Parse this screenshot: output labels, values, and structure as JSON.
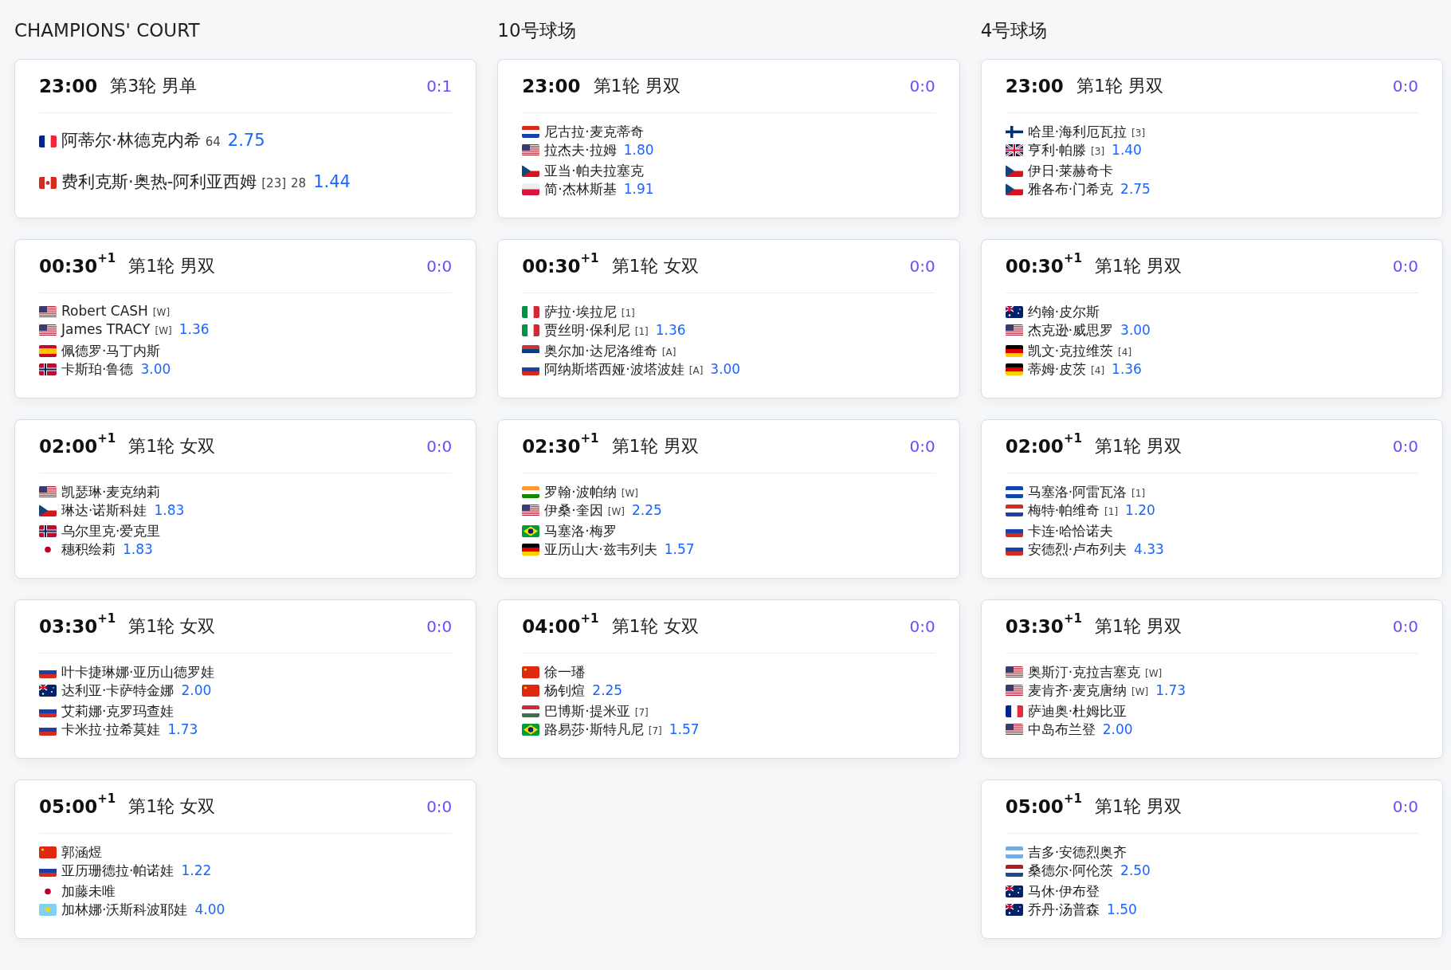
{
  "courts": [
    {
      "title": "CHAMPIONS' COURT",
      "matches": [
        {
          "time": "23:00",
          "round": "第3轮 男单",
          "score": "0:1",
          "sides": [
            {
              "players": [
                {
                  "kind": "fr",
                  "name": "阿蒂尔·林德克内希",
                  "ranking": "64"
                }
              ],
              "odds": "2.75"
            },
            {
              "players": [
                {
                  "kind": "ca",
                  "name": "费利克斯·奥热-阿利亚西姆",
                  "seed": "[23]",
                  "ranking": "28"
                }
              ],
              "odds": "1.44"
            }
          ]
        },
        {
          "time": "00:30",
          "day_offset": "+1",
          "round": "第1轮 男双",
          "score": "0:0",
          "sides": [
            {
              "players": [
                {
                  "kind": "us",
                  "name": "Robert CASH",
                  "seed": "[W]"
                },
                {
                  "kind": "us",
                  "name": "James TRACY",
                  "seed": "[W]"
                }
              ],
              "odds": "1.36"
            },
            {
              "players": [
                {
                  "kind": "es",
                  "name": "佩德罗·马丁内斯"
                },
                {
                  "kind": "no",
                  "name": "卡斯珀·鲁德"
                }
              ],
              "odds": "3.00"
            }
          ]
        },
        {
          "time": "02:00",
          "day_offset": "+1",
          "round": "第1轮 女双",
          "score": "0:0",
          "sides": [
            {
              "players": [
                {
                  "kind": "us",
                  "name": "凯瑟琳·麦克纳莉"
                },
                {
                  "kind": "cz",
                  "name": "琳达·诺斯科娃"
                }
              ],
              "odds": "1.83"
            },
            {
              "players": [
                {
                  "kind": "no",
                  "name": "乌尔里克·爱克里"
                },
                {
                  "kind": "jp",
                  "name": "穗积绘莉"
                }
              ],
              "odds": "1.83"
            }
          ]
        },
        {
          "time": "03:30",
          "day_offset": "+1",
          "round": "第1轮 女双",
          "score": "0:0",
          "sides": [
            {
              "players": [
                {
                  "kind": "ru",
                  "name": "叶卡捷琳娜·亚历山德罗娃"
                },
                {
                  "kind": "au",
                  "name": "达利亚·卡萨特金娜"
                }
              ],
              "odds": "2.00"
            },
            {
              "players": [
                {
                  "kind": "ru",
                  "name": "艾莉娜·克罗玛查娃"
                },
                {
                  "kind": "ru",
                  "name": "卡米拉·拉希莫娃"
                }
              ],
              "odds": "1.73"
            }
          ]
        },
        {
          "time": "05:00",
          "day_offset": "+1",
          "round": "第1轮 女双",
          "score": "0:0",
          "sides": [
            {
              "players": [
                {
                  "kind": "cn",
                  "name": "郭涵煜"
                },
                {
                  "kind": "ru",
                  "name": "亚历珊德拉·帕诺娃"
                }
              ],
              "odds": "1.22"
            },
            {
              "players": [
                {
                  "kind": "jp",
                  "name": "加藤未唯"
                },
                {
                  "kind": "kz",
                  "name": "加林娜·沃斯科波耶娃"
                }
              ],
              "odds": "4.00"
            }
          ]
        }
      ]
    },
    {
      "title": "10号球场",
      "matches": [
        {
          "time": "23:00",
          "round": "第1轮 男双",
          "score": "0:0",
          "sides": [
            {
              "players": [
                {
                  "kind": "hr",
                  "name": "尼古拉·麦克蒂奇"
                },
                {
                  "kind": "us",
                  "name": "拉杰夫·拉姆"
                }
              ],
              "odds": "1.80"
            },
            {
              "players": [
                {
                  "kind": "cz",
                  "name": "亚当·帕夫拉塞克"
                },
                {
                  "kind": "pl",
                  "name": "简·杰林斯基"
                }
              ],
              "odds": "1.91"
            }
          ]
        },
        {
          "time": "00:30",
          "day_offset": "+1",
          "round": "第1轮 女双",
          "score": "0:0",
          "sides": [
            {
              "players": [
                {
                  "kind": "it",
                  "name": "萨拉·埃拉尼",
                  "seed": "[1]"
                },
                {
                  "kind": "it",
                  "name": "贾丝明·保利尼",
                  "seed": "[1]"
                }
              ],
              "odds": "1.36"
            },
            {
              "players": [
                {
                  "kind": "rs",
                  "name": "奥尔加·达尼洛维奇",
                  "seed": "[A]"
                },
                {
                  "kind": "ru",
                  "name": "阿纳斯塔西娅·波塔波娃",
                  "seed": "[A]"
                }
              ],
              "odds": "3.00"
            }
          ]
        },
        {
          "time": "02:30",
          "day_offset": "+1",
          "round": "第1轮 男双",
          "score": "0:0",
          "sides": [
            {
              "players": [
                {
                  "kind": "in",
                  "name": "罗翰·波帕纳",
                  "seed": "[W]"
                },
                {
                  "kind": "us",
                  "name": "伊桑·奎因",
                  "seed": "[W]"
                }
              ],
              "odds": "2.25"
            },
            {
              "players": [
                {
                  "kind": "br",
                  "name": "马塞洛·梅罗"
                },
                {
                  "kind": "de",
                  "name": "亚历山大·兹韦列夫"
                }
              ],
              "odds": "1.57"
            }
          ]
        },
        {
          "time": "04:00",
          "day_offset": "+1",
          "round": "第1轮 女双",
          "score": "0:0",
          "sides": [
            {
              "players": [
                {
                  "kind": "cn",
                  "name": "徐一璠"
                },
                {
                  "kind": "cn",
                  "name": "杨钊煊"
                }
              ],
              "odds": "2.25"
            },
            {
              "players": [
                {
                  "kind": "hu",
                  "name": "巴博斯·提米亚",
                  "seed": "[7]"
                },
                {
                  "kind": "br",
                  "name": "路易莎·斯特凡尼",
                  "seed": "[7]"
                }
              ],
              "odds": "1.57"
            }
          ]
        }
      ]
    },
    {
      "title": "4号球场",
      "matches": [
        {
          "time": "23:00",
          "round": "第1轮 男双",
          "score": "0:0",
          "sides": [
            {
              "players": [
                {
                  "kind": "fi",
                  "name": "哈里·海利厄瓦拉",
                  "seed": "[3]"
                },
                {
                  "kind": "gb",
                  "name": "亨利·帕滕",
                  "seed": "[3]"
                }
              ],
              "odds": "1.40"
            },
            {
              "players": [
                {
                  "kind": "cz",
                  "name": "伊日·莱赫奇卡"
                },
                {
                  "kind": "cz",
                  "name": "雅各布·门希克"
                }
              ],
              "odds": "2.75"
            }
          ]
        },
        {
          "time": "00:30",
          "day_offset": "+1",
          "round": "第1轮 男双",
          "score": "0:0",
          "sides": [
            {
              "players": [
                {
                  "kind": "au",
                  "name": "约翰·皮尔斯"
                },
                {
                  "kind": "us",
                  "name": "杰克逊·威思罗"
                }
              ],
              "odds": "3.00"
            },
            {
              "players": [
                {
                  "kind": "de",
                  "name": "凯文·克拉维茨",
                  "seed": "[4]"
                },
                {
                  "kind": "de",
                  "name": "蒂姆·皮茨",
                  "seed": "[4]"
                }
              ],
              "odds": "1.36"
            }
          ]
        },
        {
          "time": "02:00",
          "day_offset": "+1",
          "round": "第1轮 男双",
          "score": "0:0",
          "sides": [
            {
              "players": [
                {
                  "kind": "sv",
                  "name": "马塞洛·阿雷瓦洛",
                  "seed": "[1]"
                },
                {
                  "kind": "hr",
                  "name": "梅特·帕维奇",
                  "seed": "[1]"
                }
              ],
              "odds": "1.20"
            },
            {
              "players": [
                {
                  "kind": "ru",
                  "name": "卡连·哈恰诺夫"
                },
                {
                  "kind": "ru",
                  "name": "安德烈·卢布列夫"
                }
              ],
              "odds": "4.33"
            }
          ]
        },
        {
          "time": "03:30",
          "day_offset": "+1",
          "round": "第1轮 男双",
          "score": "0:0",
          "sides": [
            {
              "players": [
                {
                  "kind": "us",
                  "name": "奥斯汀·克拉吉塞克",
                  "seed": "[W]"
                },
                {
                  "kind": "us",
                  "name": "麦肯齐·麦克唐纳",
                  "seed": "[W]"
                }
              ],
              "odds": "1.73"
            },
            {
              "players": [
                {
                  "kind": "fr",
                  "name": "萨迪奥·杜姆比亚"
                },
                {
                  "kind": "us",
                  "name": "中岛布兰登"
                }
              ],
              "odds": "2.00"
            }
          ]
        },
        {
          "time": "05:00",
          "day_offset": "+1",
          "round": "第1轮 男双",
          "score": "0:0",
          "sides": [
            {
              "players": [
                {
                  "kind": "ar",
                  "name": "吉多·安德烈奥齐"
                },
                {
                  "kind": "nl",
                  "name": "桑德尔·阿伦茨"
                }
              ],
              "odds": "2.50"
            },
            {
              "players": [
                {
                  "kind": "au",
                  "name": "马休·伊布登"
                },
                {
                  "kind": "au",
                  "name": "乔丹·汤普森"
                }
              ],
              "odds": "1.50"
            }
          ]
        }
      ]
    }
  ]
}
